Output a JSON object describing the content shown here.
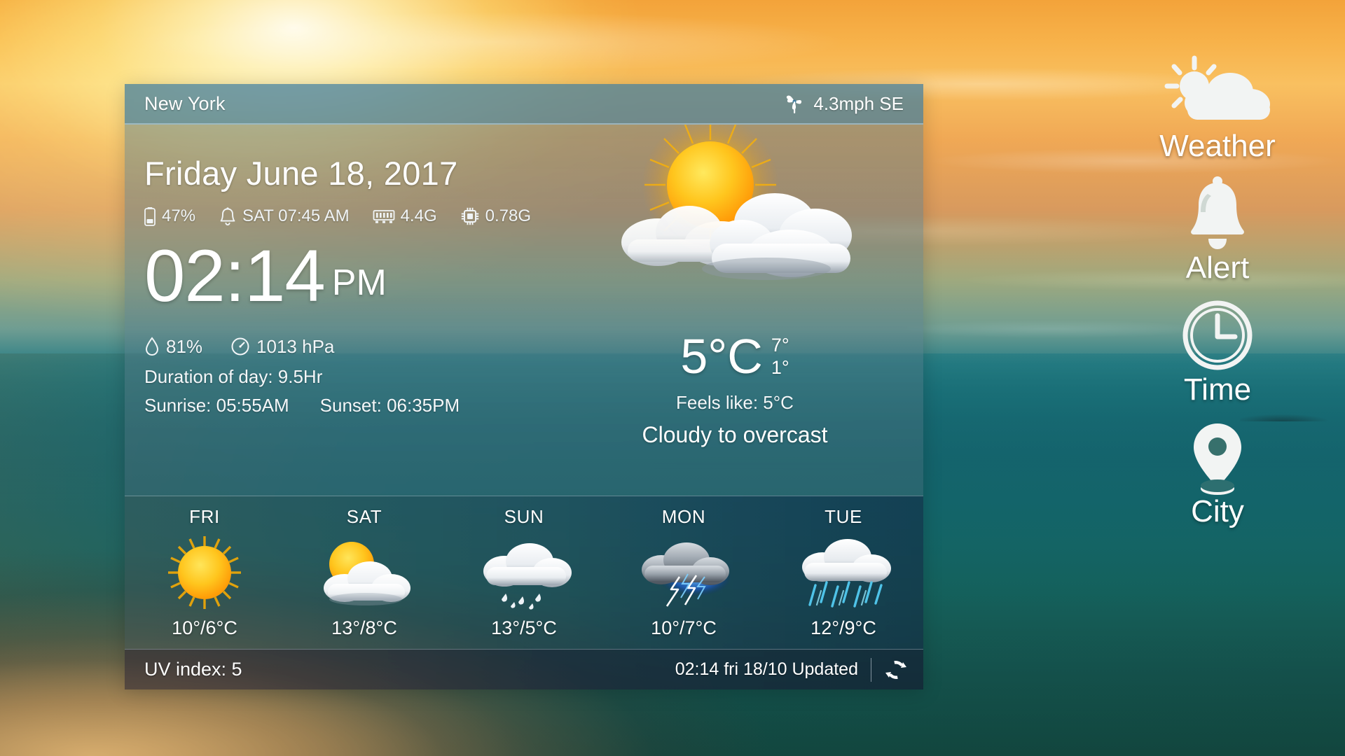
{
  "widget": {
    "header": {
      "city": "New York",
      "wind": "4.3mph SE",
      "wind_icon": "pinwheel-icon"
    },
    "date": "Friday June 18, 2017",
    "status": [
      {
        "icon": "battery-icon",
        "value": "47%"
      },
      {
        "icon": "alarm-bell-icon",
        "value": "SAT 07:45 AM"
      },
      {
        "icon": "ram-icon",
        "value": "4.4G"
      },
      {
        "icon": "cpu-icon",
        "value": "0.78G"
      }
    ],
    "clock": {
      "time": "02:14",
      "ampm": "PM"
    },
    "humidity": {
      "icon": "water-drop-icon",
      "value": "81%"
    },
    "pressure": {
      "icon": "barometer-icon",
      "value": "1013 hPa"
    },
    "duration_of_day": "Duration of day: 9.5Hr",
    "sunrise": "Sunrise: 05:55AM",
    "sunset": "Sunset: 06:35PM",
    "current": {
      "icon": "sun-behind-cloud-icon",
      "temperature": "5°C",
      "high": "7°",
      "low": "1°",
      "feels_like": "Feels like:  5°C",
      "condition": "Cloudy to overcast"
    },
    "forecast": [
      {
        "day": "FRI",
        "icon": "sunny-icon",
        "temps": "10°/6°C"
      },
      {
        "day": "SAT",
        "icon": "partly-cloudy-icon",
        "temps": "13°/8°C"
      },
      {
        "day": "SUN",
        "icon": "rain-icon",
        "temps": "13°/5°C"
      },
      {
        "day": "MON",
        "icon": "thunderstorm-icon",
        "temps": "10°/7°C"
      },
      {
        "day": "TUE",
        "icon": "heavy-rain-icon",
        "temps": "12°/9°C"
      }
    ],
    "footer": {
      "uv_index": "UV index: 5",
      "updated": "02:14 fri 18/10 Updated",
      "refresh_icon": "refresh-icon"
    }
  },
  "sidebar": [
    {
      "label": "Weather",
      "icon": "sun-cloud-icon"
    },
    {
      "label": "Alert",
      "icon": "bell-icon"
    },
    {
      "label": "Time",
      "icon": "clock-icon"
    },
    {
      "label": "City",
      "icon": "map-pin-icon"
    }
  ],
  "colors": {
    "panel_header": "#3f7c9e",
    "accent_sun": "#ffc107",
    "text": "#ffffff"
  }
}
